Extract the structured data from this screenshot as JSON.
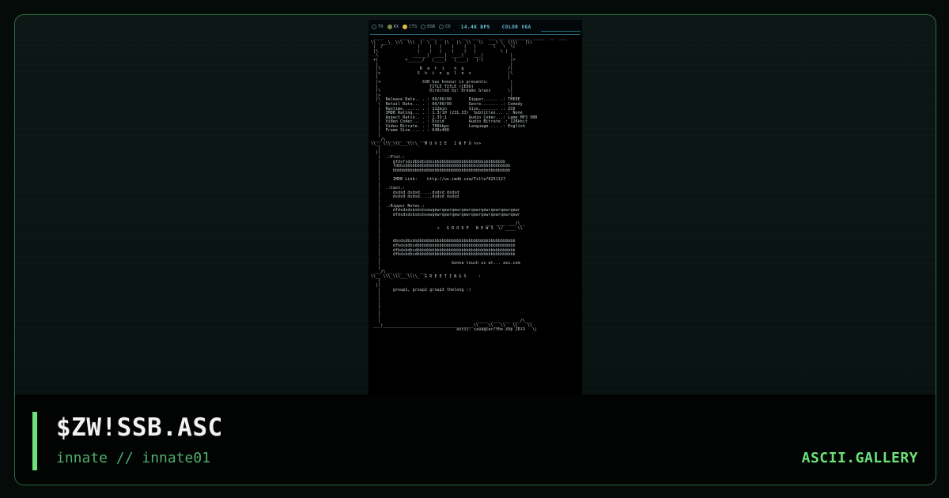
{
  "card": {
    "title": "$ZW!SSB.ASC",
    "subtitle": "innate // innate01",
    "brand": "ASCII.GALLERY"
  },
  "terminal": {
    "indicators": [
      {
        "label": "TX",
        "state": "off"
      },
      {
        "label": "RX",
        "state": "dim"
      },
      {
        "label": "CTS",
        "state": "on"
      },
      {
        "label": "DSR",
        "state": "off"
      },
      {
        "label": "CD",
        "state": "off"
      }
    ],
    "speed": "14.4K BPS",
    "mode": "COLOR VGA",
    "ascii_art": " ____       ____    __  ___ __   _   ___ ____   ___ ___ _________ _____  __  ___ \n\\\\  ___\\_ \\\\\\  \\\\\\  |  \\  |   |\\   |\\  \\\\   \\\\  ___\\ \\  \\\\\\\\   |\\\\\n |  /              |    |   |    |    |   |       \\   \\  \\|\n |\\                |    |   |    |    |   |          \\ |\n  \\              ______|  ____|  ____|    ___|           |\n +|           <______/   |____)   |____)   |-)           |>\n  |                                                      |\n  |\\                R  a  t  i    n  g                  /|\n  |>               S  h  i  n  g  l  e  s               |\\\n  |                                                     |\n  |<                 SSB has honour in presents:         |\n  |                     TITLE TITLE (CEOO)               |\n  |\\                    Directed by: Dreams Grass       \\|\n  |>                                                     |\n  |\\  Release Date.. . : 00/00/00       Ripper...... .: THERE\n   \\  Retail Date... . : 00/00/00       Genre....... .: Comedy\n   |  Runtime....... . : 112min         Size........ .: 2CD\n   |  IMDB Rating... . : 1.3/10 (231.33)  Subtitles... .: None\n   |  Aspect Ratio.. . : 1.33:1         Audio Codec. .: Lame MP3 VBR\n   |  Video Codec... . : Divid          Audio Bitrate .: 128kbit\n   |  Video Bitrate. . : 700kbps        Language.... .: English\n   |  Frame Size.... . : 640x480\n   |\n ___/\\___ ___ ___   ___\n\\\\__ \\\\\\_\\\\\\___\\\\\\\\_  M O V I E   I N F O >>>\n   |\n  ||\n   |  .:Plot.:\n   |     gfdsfsdsdbbdbsbbsbbbbbbbbbbbbbbbbbbbbsbbbbbbbb\n   |     fdbbsbbbbbbbbbbbbbbbbbbbbbbbbbbbbbsbbbbbbbbbbbbb\n   |     bbbbbbbbbbbbbbbbbbbbbbbbbbbbbbbbbbbbbbbbbbbbbbbb\n   |\n   |     IMDB Link:    http://us.imdb.com/Title?0251127\n   |\n   |  .:Cast.:\n   |     dsdsd dsdsd. ...dsdsd dsdsd\n   |     dsdsd dsdsd. ...dsdsd dsdsd\n   |\n   |  .:Ripper Notes.:\n   |     dfdsdsdsbsbsbsewqewrqewrqewrqewrqewrqewrqewrqewrqewr\n   |     dfdsdsdsbsbsbsewqewrqewrqewrqewrqewrqewrqewrqewrqewr\n   |\n   |                                           ___ ____ ___/\\__\n   |                       <   G R O U P   N E W S  \\/ ____ \\\\\n   |\n   |\n   |     dbsdsdbsdsbbbbbbbbbbbbbbbbbbbbbbbbbbbbbbbbbbbbbbbb\n   |     dfbdsbdbsdbbbbbbbbbbbbbbbbbbbbbbbbbbbbbbbbbbbbbbbb\n   |     dfbdsbdbsdbbbbbbbbbbbbbbbbbbbbbbbbbbbbbbbbbbbbbbbb\n   |     dfbdsbdbsdbbbbbbbbbbbbbbbbbbbbbbbbbbbbbbbbbbbbbbbb\n   |\n   |                             Gonna touch us at... ass.com\n   |\n ___/\\___ ___ ___   ___\n\\\\__ \\\\\\_\\\\\\___\\\\\\\\_  G R E E T I N G S     :\n   |\n  ||\n   |     group1, group2 group3 thelong :)\n   |\n   |\n   |\n   |\n   |\n   |\n   |                                       _____ ____ ___ ___/\\___\n ___|_____________________________________\\\\____\\\\___\\\\___\\\\__  \\\\\n                                   ascii: szwagier/the.ckp 26+3   \\|"
  }
}
